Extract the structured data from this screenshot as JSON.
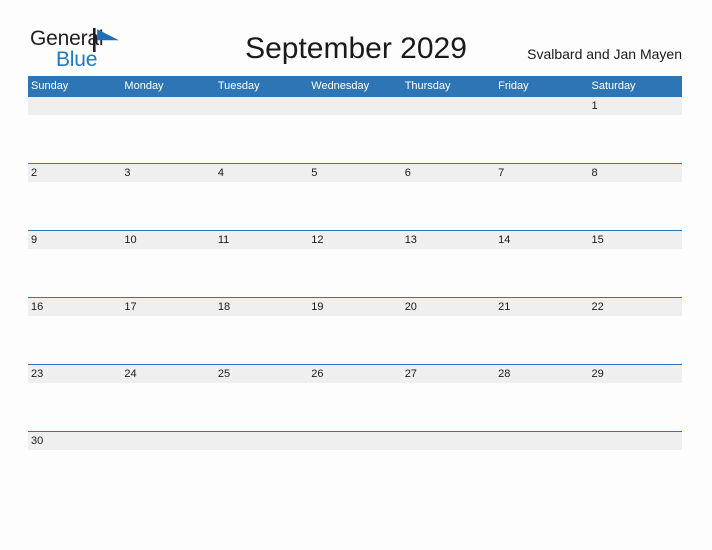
{
  "brand": {
    "name_part1": "General",
    "name_part2": "Blue",
    "logo_icon": "flag-triangle-icon",
    "color_dark": "#231f20",
    "color_blue": "#1f7ac4"
  },
  "header": {
    "title": "September 2029",
    "region": "Svalbard and Jan Mayen"
  },
  "calendar": {
    "header_bg": "#2e75b6",
    "band_bg": "#efefef",
    "weekdays": [
      "Sunday",
      "Monday",
      "Tuesday",
      "Wednesday",
      "Thursday",
      "Friday",
      "Saturday"
    ],
    "weeks": [
      [
        "",
        "",
        "",
        "",
        "",
        "",
        "1"
      ],
      [
        "2",
        "3",
        "4",
        "5",
        "6",
        "7",
        "8"
      ],
      [
        "9",
        "10",
        "11",
        "12",
        "13",
        "14",
        "15"
      ],
      [
        "16",
        "17",
        "18",
        "19",
        "20",
        "21",
        "22"
      ],
      [
        "23",
        "24",
        "25",
        "26",
        "27",
        "28",
        "29"
      ],
      [
        "30",
        "",
        "",
        "",
        "",
        "",
        ""
      ]
    ]
  }
}
